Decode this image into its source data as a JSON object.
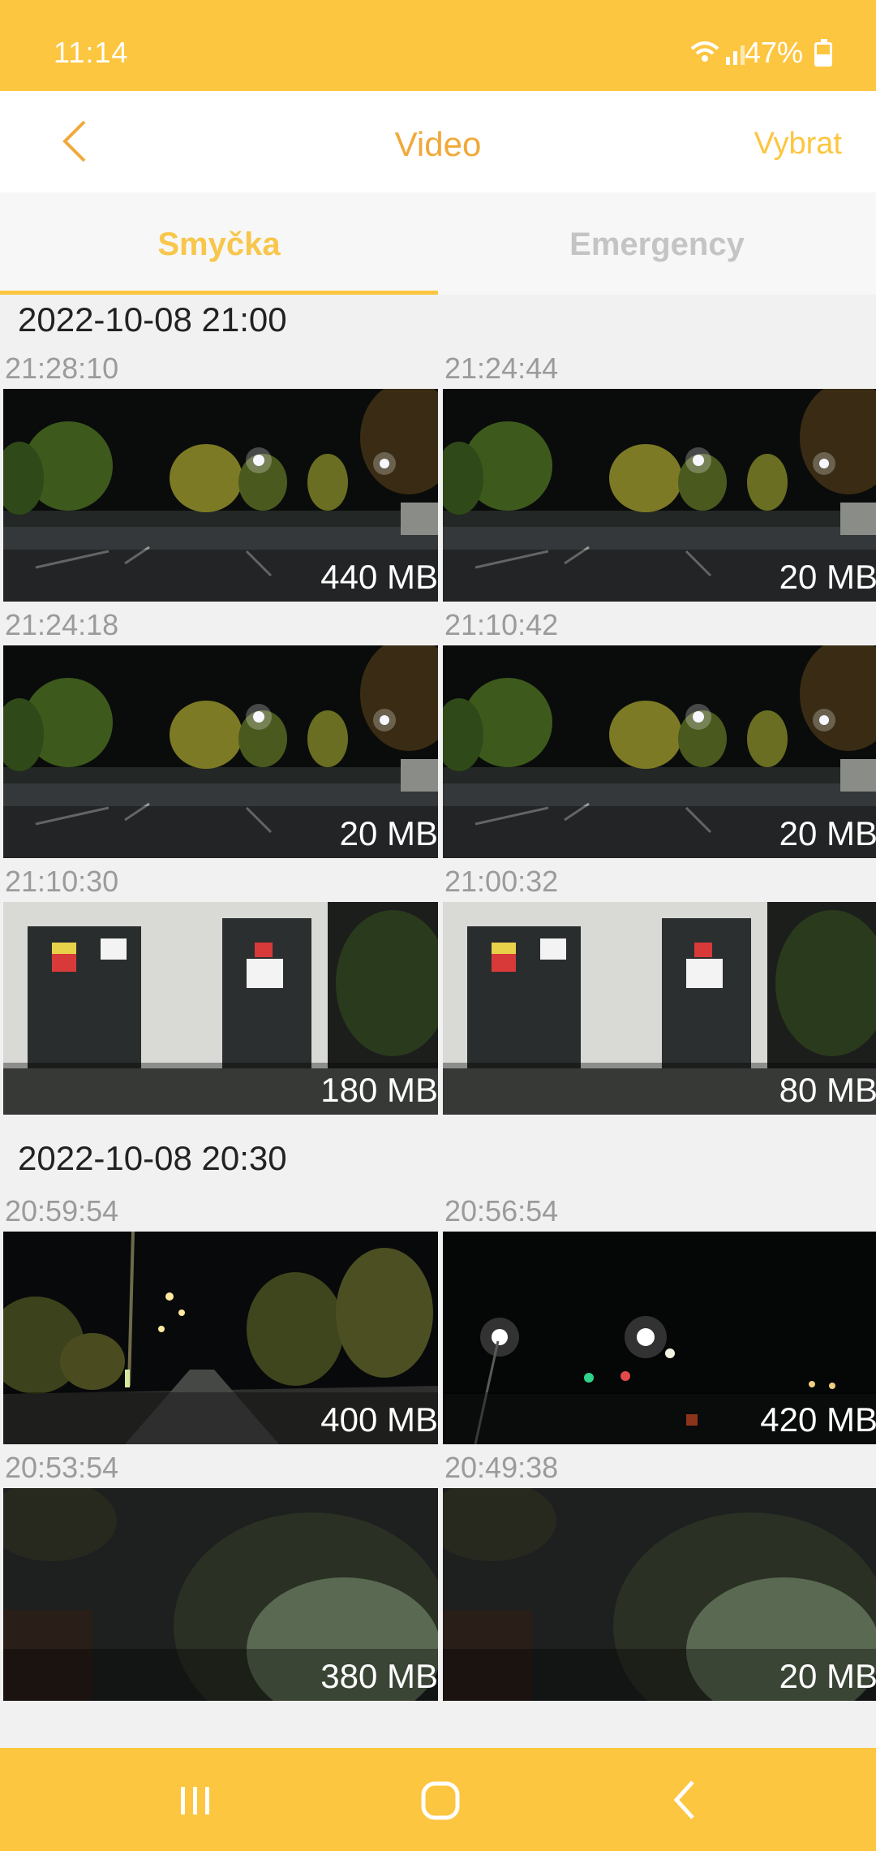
{
  "status_bar": {
    "time": "11:14",
    "battery": "47%"
  },
  "header": {
    "title": "Video",
    "select_label": "Vybrat"
  },
  "tabs": [
    {
      "label": "Smyčka",
      "active": true
    },
    {
      "label": "Emergency",
      "active": false
    }
  ],
  "groups": [
    {
      "title": "2022-10-08 21:00",
      "items": [
        {
          "time": "21:28:10",
          "size": "440 MB",
          "scene": "night-road-trees"
        },
        {
          "time": "21:24:44",
          "size": "20 MB",
          "scene": "night-road-trees"
        },
        {
          "time": "21:24:18",
          "size": "20 MB",
          "scene": "night-road-trees"
        },
        {
          "time": "21:10:42",
          "size": "20 MB",
          "scene": "night-road-trees"
        },
        {
          "time": "21:10:30",
          "size": "180 MB",
          "scene": "building-doors"
        },
        {
          "time": "21:00:32",
          "size": "80 MB",
          "scene": "building-doors"
        }
      ]
    },
    {
      "title": "2022-10-08 20:30",
      "items": [
        {
          "time": "20:59:54",
          "size": "400 MB",
          "scene": "night-street-lights"
        },
        {
          "time": "20:56:54",
          "size": "420 MB",
          "scene": "night-traffic-lights"
        },
        {
          "time": "20:53:54",
          "size": "380 MB",
          "scene": "dark-trees"
        },
        {
          "time": "20:49:38",
          "size": "20 MB",
          "scene": "dark-trees"
        }
      ]
    }
  ],
  "colors": {
    "accent": "#fdc640",
    "title": "#f0a93a",
    "tab_inactive": "#c4c4c4"
  },
  "nav": {
    "icons": [
      "recent-apps-icon",
      "home-icon",
      "back-icon"
    ]
  }
}
